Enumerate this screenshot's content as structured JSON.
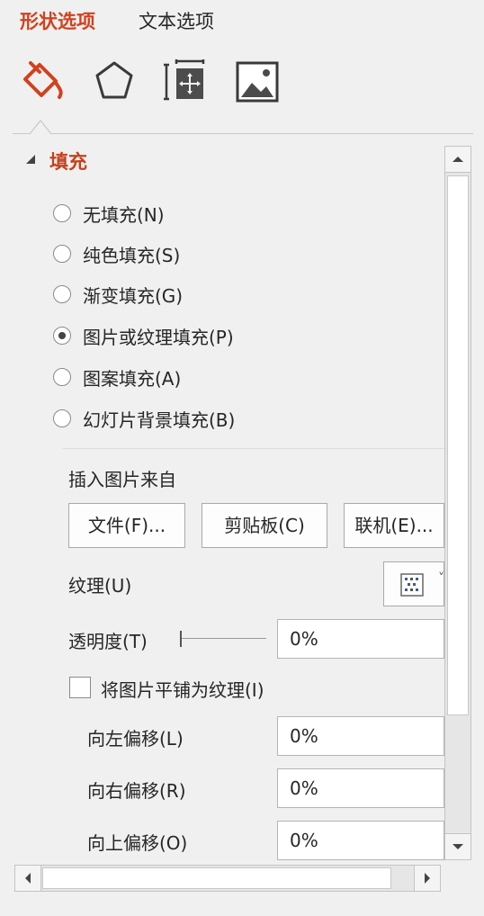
{
  "tabs": {
    "shape_options": "形状选项",
    "text_options": "文本选项"
  },
  "icon_tabs": [
    "fill-line-icon",
    "effects-pentagon-icon",
    "size-properties-icon",
    "picture-icon"
  ],
  "fill_section": {
    "title": "填充",
    "options": [
      {
        "label": "无填充(N)",
        "checked": false
      },
      {
        "label": "纯色填充(S)",
        "checked": false
      },
      {
        "label": "渐变填充(G)",
        "checked": false
      },
      {
        "label": "图片或纹理填充(P)",
        "checked": true
      },
      {
        "label": "图案填充(A)",
        "checked": false
      },
      {
        "label": "幻灯片背景填充(B)",
        "checked": false
      }
    ]
  },
  "picture_source": {
    "label": "插入图片来自",
    "file_button": "文件(F)...",
    "clipboard_button": "剪贴板(C)",
    "online_button": "联机(E)..."
  },
  "texture": {
    "label": "纹理(U)"
  },
  "transparency": {
    "label": "透明度(T)",
    "value": "0%"
  },
  "tile": {
    "label": "将图片平铺为纹理(I)",
    "checked": false
  },
  "offsets": [
    {
      "label": "向左偏移(L)",
      "value": "0%"
    },
    {
      "label": "向右偏移(R)",
      "value": "0%"
    },
    {
      "label": "向上偏移(O)",
      "value": "0%"
    }
  ],
  "colors": {
    "accent": "#d2411e",
    "background": "#f0f0f0"
  }
}
